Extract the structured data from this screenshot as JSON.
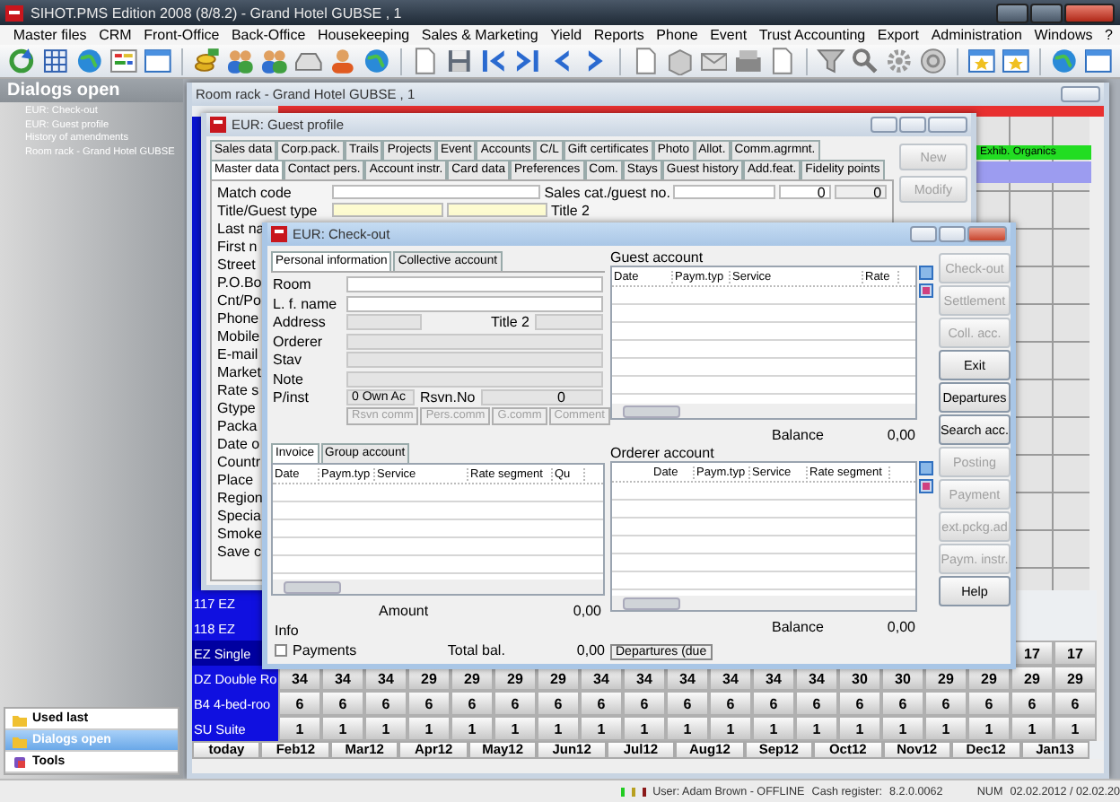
{
  "window": {
    "title": "SIHOT.PMS Edition 2008 (8/8.2) - Grand Hotel GUBSE , 1"
  },
  "menu": [
    "Master files",
    "CRM",
    "Front-Office",
    "Back-Office",
    "Housekeeping",
    "Sales & Marketing",
    "Yield",
    "Reports",
    "Phone",
    "Event",
    "Trust Accounting",
    "Export",
    "Administration",
    "Windows",
    "?"
  ],
  "sidebar": {
    "header": "Dialogs open",
    "items": [
      "EUR: Check-out",
      "EUR: Guest profile",
      "History of amendments",
      "Room rack - Grand Hotel GUBSE"
    ],
    "nav": [
      {
        "label": "Used last",
        "selected": false
      },
      {
        "label": "Dialogs open",
        "selected": true
      },
      {
        "label": "Tools",
        "selected": false
      }
    ]
  },
  "room_rack": {
    "title": "Room rack - Grand Hotel GUBSE , 1",
    "event": "Exhib. Organics",
    "rows": [
      {
        "label": "117 EZ",
        "values": []
      },
      {
        "label": "118 EZ",
        "values": []
      },
      {
        "label": "EZ Single",
        "values": [
          "17",
          "17"
        ]
      },
      {
        "label": "DZ Double Ro",
        "values": [
          "34",
          "34",
          "34",
          "29",
          "29",
          "29",
          "29",
          "34",
          "34",
          "34",
          "34",
          "34",
          "34",
          "30",
          "30",
          "29",
          "29",
          "29",
          "29"
        ]
      },
      {
        "label": "B4 4-bed-roo",
        "values": [
          "6",
          "6",
          "6",
          "6",
          "6",
          "6",
          "6",
          "6",
          "6",
          "6",
          "6",
          "6",
          "6",
          "6",
          "6",
          "6",
          "6",
          "6",
          "6"
        ]
      },
      {
        "label": "SU Suite",
        "values": [
          "1",
          "1",
          "1",
          "1",
          "1",
          "1",
          "1",
          "1",
          "1",
          "1",
          "1",
          "1",
          "1",
          "1",
          "1",
          "1",
          "1",
          "1",
          "1"
        ]
      }
    ],
    "months": [
      "today",
      "Feb12",
      "Mar12",
      "Apr12",
      "May12",
      "Jun12",
      "Jul12",
      "Aug12",
      "Sep12",
      "Oct12",
      "Nov12",
      "Dec12",
      "Jan13"
    ]
  },
  "guest_profile": {
    "title": "EUR: Guest profile",
    "tabs_top": [
      {
        "label": "Sales data",
        "selected": false
      },
      {
        "label": "Corp.pack.",
        "selected": false
      },
      {
        "label": "Trails",
        "selected": false
      },
      {
        "label": "Projects",
        "selected": false
      },
      {
        "label": "Event",
        "selected": false
      },
      {
        "label": "Accounts",
        "selected": false
      },
      {
        "label": "C/L",
        "selected": false
      },
      {
        "label": "Gift certificates",
        "selected": false
      },
      {
        "label": "Photo",
        "selected": false
      },
      {
        "label": "Allot.",
        "selected": false
      },
      {
        "label": "Comm.agrmnt.",
        "selected": false
      }
    ],
    "tabs_bottom": [
      {
        "label": "Master data",
        "selected": true
      },
      {
        "label": "Contact pers.",
        "selected": false
      },
      {
        "label": "Account instr.",
        "selected": false
      },
      {
        "label": "Card data",
        "selected": false
      },
      {
        "label": "Preferences",
        "selected": false
      },
      {
        "label": "Com.",
        "selected": false
      },
      {
        "label": "Stays",
        "selected": false
      },
      {
        "label": "Guest history",
        "selected": false
      },
      {
        "label": "Add.feat.",
        "selected": false
      },
      {
        "label": "Fidelity points",
        "selected": false
      }
    ],
    "match_code": "Match code",
    "title_type": "Title/Guest type",
    "title_2": "Title 2",
    "sales_cat": "Sales cat./guest no.",
    "guest_no": [
      "0",
      "0"
    ],
    "labels": [
      "Last na",
      "First n",
      "Street",
      "P.O.Bo",
      "Cnt/Po",
      "Phone",
      "Mobile",
      "E-mail",
      "Market",
      "Rate s",
      "Gtype",
      "Packa",
      "Date o",
      "Countr",
      "Place",
      "Region",
      "Specia",
      "Smoke",
      "Save c"
    ],
    "buttons": [
      {
        "label": "New",
        "disabled": true
      },
      {
        "label": "Modify",
        "disabled": true
      }
    ]
  },
  "check_out": {
    "title": "EUR: Check-out",
    "tabs": [
      {
        "label": "Personal information",
        "selected": true
      },
      {
        "label": "Collective account",
        "selected": false
      }
    ],
    "room": "Room",
    "name": "L. f. name",
    "address": "Address",
    "title_2": "Title 2",
    "orderer": "Orderer",
    "stay": "Stav",
    "note": "Note",
    "pinst": "P/inst",
    "pinst_value": "0 Own Ac",
    "rsvn_label": "Rsvn.No",
    "rsvn_value": "0",
    "small_buttons": [
      {
        "label": "Rsvn comm",
        "disabled": true
      },
      {
        "label": "Pers.comm",
        "disabled": true
      },
      {
        "label": "G.comm",
        "disabled": true
      },
      {
        "label": "Comment",
        "disabled": true
      }
    ],
    "invoice_tabs": [
      {
        "label": "Invoice",
        "selected": true
      },
      {
        "label": "Group account",
        "selected": false
      }
    ],
    "invoice_columns": [
      "Date",
      "Paym.typ",
      "Service",
      "Rate segment",
      "Qu"
    ],
    "amount_label": "Amount",
    "amount": "0,00",
    "info": "Info",
    "payments": {
      "label": "Payments",
      "checked": false
    },
    "total_label": "Total bal.",
    "total": "0,00",
    "guest_account": {
      "title": "Guest account",
      "columns": [
        "Date",
        "Paym.typ",
        "Service",
        "Rate"
      ],
      "balance_label": "Balance",
      "balance": "0,00"
    },
    "orderer_account": {
      "title": "Orderer account",
      "columns": [
        "Date",
        "Paym.typ",
        "Service",
        "Rate segment"
      ],
      "balance_label": "Balance",
      "balance": "0,00"
    },
    "departures_due": "Departures (due",
    "buttons": [
      {
        "label": "Check-out",
        "disabled": true
      },
      {
        "label": "Settlement",
        "disabled": true
      },
      {
        "label": "Coll. acc.",
        "disabled": true
      },
      {
        "label": "Exit",
        "disabled": false
      },
      {
        "label": "Departures",
        "disabled": false
      },
      {
        "label": "Search acc.",
        "disabled": false
      },
      {
        "label": "Posting",
        "disabled": true
      },
      {
        "label": "Payment",
        "disabled": true
      },
      {
        "label": "ext.pckg.ad",
        "disabled": true
      },
      {
        "label": "Paym. instr.",
        "disabled": true
      },
      {
        "label": "Help",
        "disabled": false
      }
    ]
  },
  "status_bar": {
    "lights": [
      {
        "color": "#22cc22"
      },
      {
        "color": "#b8a020"
      },
      {
        "color": "#8b1a1a"
      }
    ],
    "user": "User: Adam Brown - OFFLINE",
    "cash_label": "Cash register:",
    "cash": "8.2.0.0062",
    "num": "NUM",
    "date": "02.02.2012 / 02.02.20"
  }
}
